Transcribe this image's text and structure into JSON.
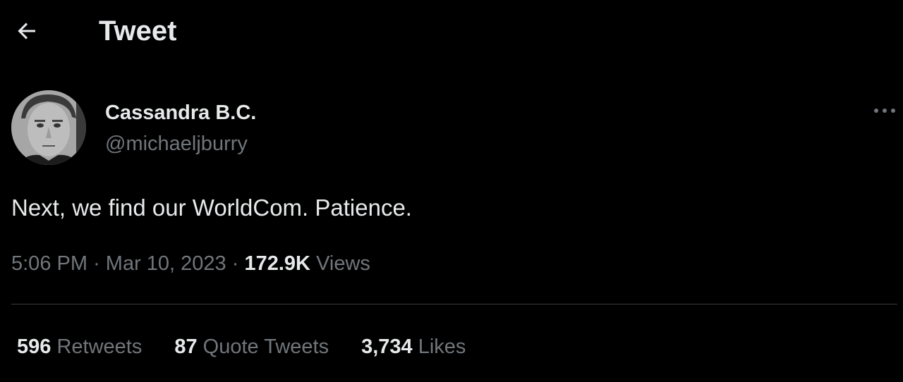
{
  "header": {
    "title": "Tweet",
    "back_icon": "arrow-left-icon"
  },
  "author": {
    "display_name": "Cassandra B.C.",
    "handle": "@michaeljburry",
    "avatar_icon": "avatar"
  },
  "tweet": {
    "text": "Next, we find our WorldCom. Patience.",
    "time": "5:06 PM",
    "separator": "·",
    "date": "Mar 10, 2023",
    "views_count": "172.9K",
    "views_label": "Views"
  },
  "more_icon": "more-horizontal-icon",
  "stats": {
    "retweets_count": "596",
    "retweets_label": "Retweets",
    "quotes_count": "87",
    "quotes_label": "Quote Tweets",
    "likes_count": "3,734",
    "likes_label": "Likes"
  },
  "colors": {
    "background": "#000000",
    "primary_text": "#e7e9ea",
    "secondary_text": "#71767b",
    "divider": "#3a3d40"
  }
}
